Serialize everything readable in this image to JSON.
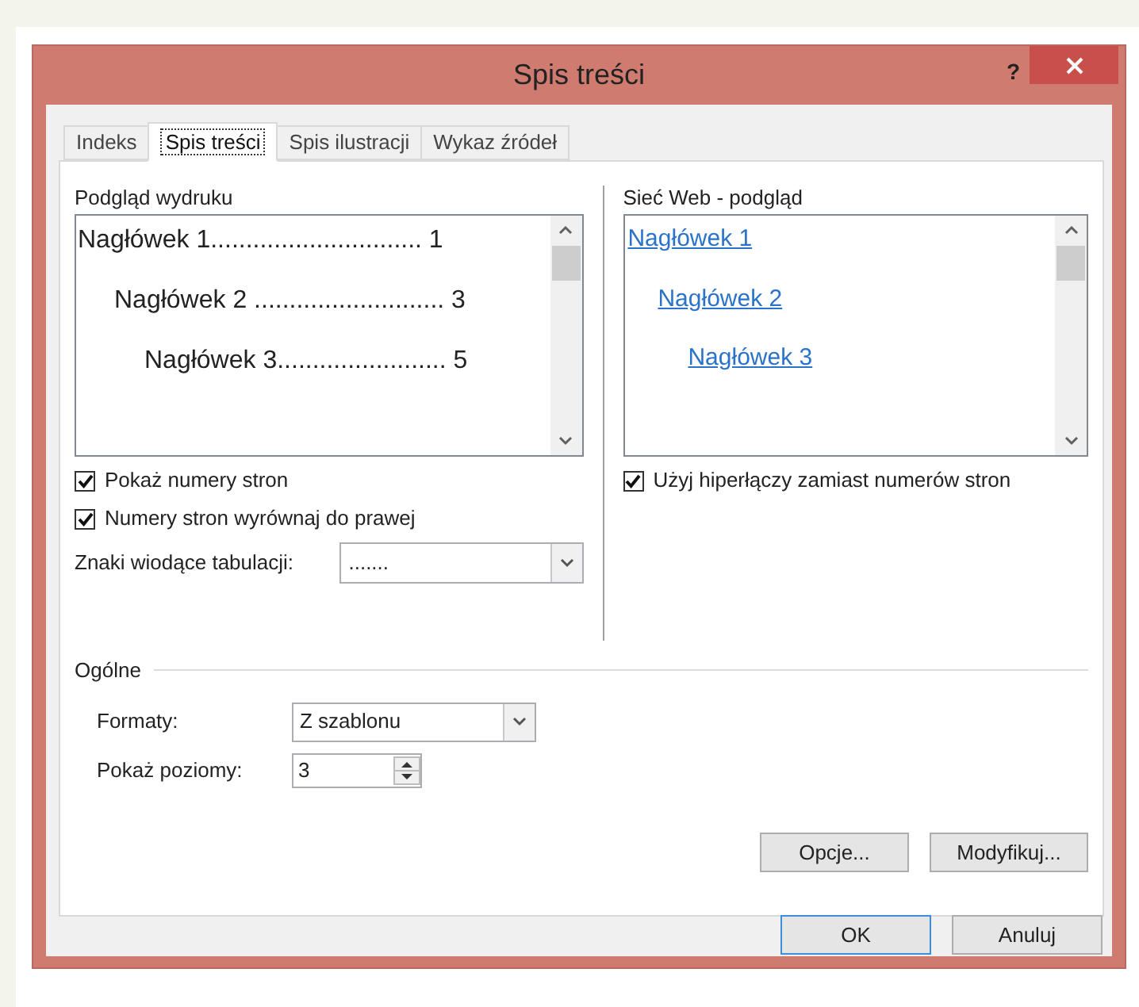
{
  "window": {
    "title": "Spis treści",
    "help": "?"
  },
  "tabs": [
    {
      "label": "Indeks",
      "selected": false
    },
    {
      "label": "Spis treści",
      "selected": true
    },
    {
      "label": "Spis ilustracji",
      "selected": false
    },
    {
      "label": "Wykaz źródeł",
      "selected": false
    }
  ],
  "print_preview": {
    "label": "Podgląd wydruku",
    "entries": [
      {
        "text": "Nagłówek 1",
        "leader": "..............................",
        "page": "1"
      },
      {
        "text": "Nagłówek 2",
        "leader": " ...........................",
        "page": "3"
      },
      {
        "text": "Nagłówek 3",
        "leader": "........................",
        "page": "5"
      }
    ],
    "options": [
      {
        "label": "Pokaż numery stron",
        "checked": true
      },
      {
        "label": "Numery stron wyrównaj do prawej",
        "checked": true
      }
    ],
    "tab_leader": {
      "label": "Znaki wiodące tabulacji:",
      "value": "......."
    }
  },
  "web_preview": {
    "label": "Sieć Web - podgląd",
    "entries": [
      "Nagłówek 1",
      "Nagłówek 2",
      "Nagłówek 3"
    ],
    "option": {
      "label": "Użyj hiperłączy zamiast numerów stron",
      "checked": true
    }
  },
  "general": {
    "label": "Ogólne",
    "formats": {
      "label": "Formaty:",
      "value": "Z szablonu"
    },
    "levels": {
      "label": "Pokaż poziomy:",
      "value": "3"
    }
  },
  "panel_buttons": [
    "Opcje...",
    "Modyfikuj..."
  ],
  "buttons": [
    {
      "label": "OK",
      "selected": true
    },
    {
      "label": "Anuluj",
      "selected": false
    }
  ]
}
